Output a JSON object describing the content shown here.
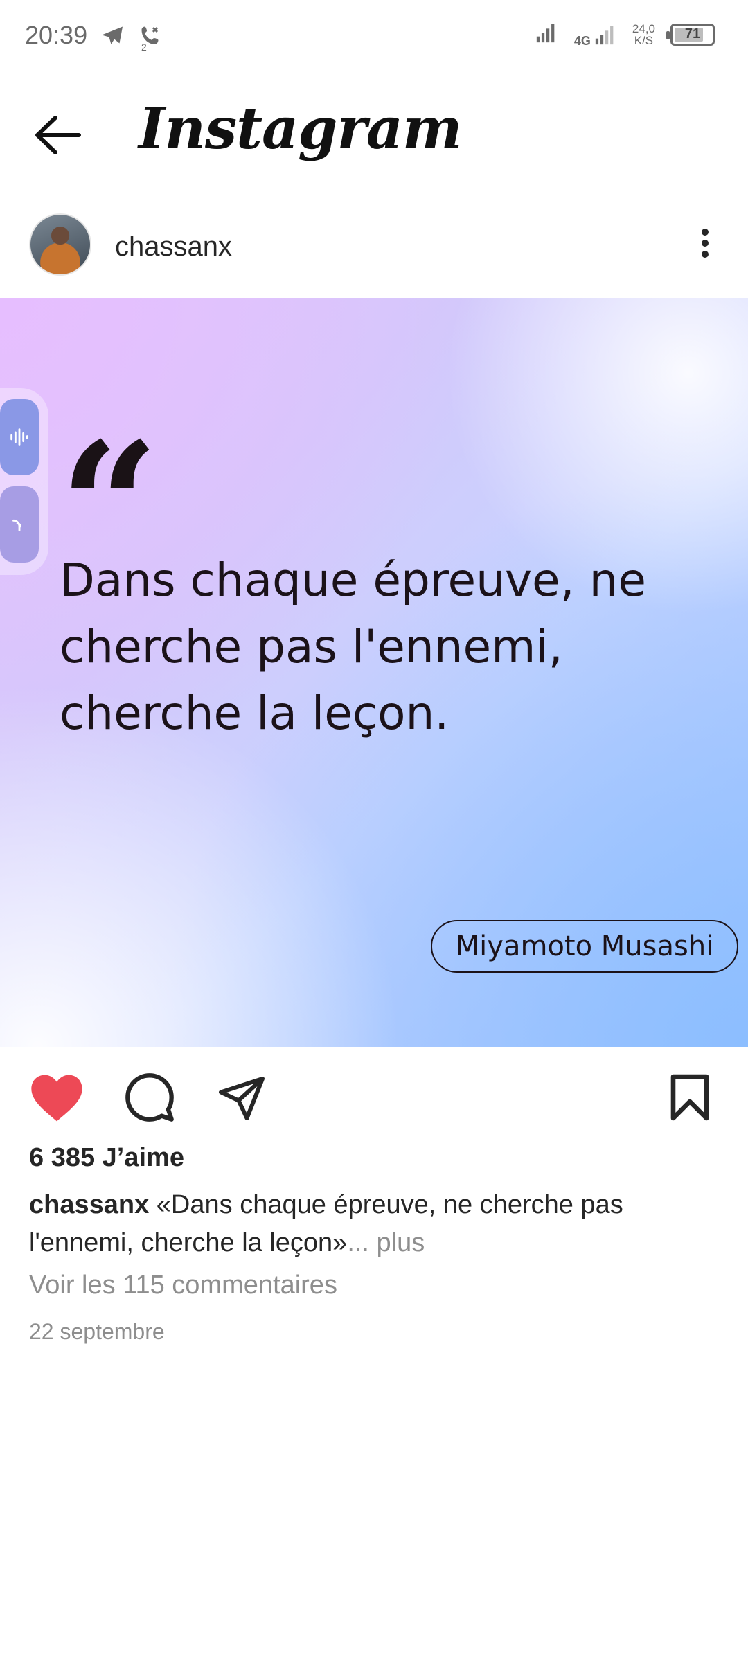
{
  "status_bar": {
    "time": "20:39",
    "notifications": [
      "telegram-icon",
      "missed-call-icon"
    ],
    "call_badge": "2",
    "network_type": "4G",
    "speed_value": "24,0",
    "speed_unit": "K/S",
    "battery": "71"
  },
  "app": {
    "brand": "Instagram"
  },
  "post": {
    "username": "chassanx",
    "image": {
      "quote_mark": "“",
      "quote": "Dans chaque épreuve, ne cherche pas l'ennemi, cherche la leçon.",
      "author": "Miyamoto Musashi"
    },
    "liked": true,
    "likes": "6 385 J’aime",
    "caption_user": "chassanx",
    "caption_text": " «Dans chaque épreuve, ne cherche pas l'ennemi, cherche la leçon»",
    "caption_more": "... plus",
    "comments_link": "Voir les 115 commentaires",
    "date": "22 septembre"
  },
  "colors": {
    "like_red": "#ed4956",
    "text_primary": "#262626",
    "text_secondary": "#8e8e8e"
  }
}
